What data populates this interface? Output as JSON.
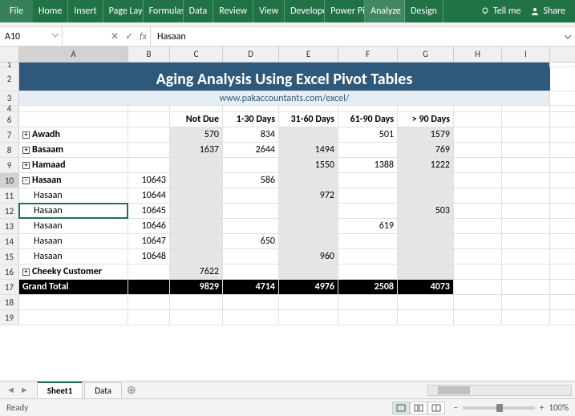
{
  "ribbon": {
    "tabs": [
      "File",
      "Home",
      "Insert",
      "Page Layout",
      "Formulas",
      "Data",
      "Review",
      "View",
      "Developer",
      "Power Pivot",
      "Analyze",
      "Design"
    ],
    "tellme": "Tell me",
    "share": "Share"
  },
  "namebox": "A10",
  "formula": "Hasaan",
  "columns": [
    "A",
    "B",
    "C",
    "D",
    "E",
    "F",
    "G",
    "H",
    "I"
  ],
  "title": "Aging Analysis Using Excel Pivot Tables",
  "url": "www.pakaccountants.com/excel/",
  "headers": {
    "c": "Not Due",
    "d": "1-30 Days",
    "e": "31-60 Days",
    "f": "61-90 Days",
    "g": "> 90 Days"
  },
  "rows": {
    "awadh": {
      "label": "Awadh",
      "exp": "+",
      "c": "570",
      "d": "834",
      "f": "501",
      "g": "1579"
    },
    "basaam": {
      "label": "Basaam",
      "exp": "+",
      "c": "1637",
      "d": "2644",
      "e": "1494",
      "g": "769"
    },
    "hamaad": {
      "label": "Hamaad",
      "exp": "+",
      "e": "1550",
      "f": "1388",
      "g": "1222"
    },
    "hasaan": {
      "label": "Hasaan",
      "exp": "−",
      "b": "10643",
      "d": "586"
    },
    "h1": {
      "label": "Hasaan",
      "b": "10644",
      "e": "972"
    },
    "h2": {
      "label": "Hasaan",
      "b": "10645",
      "g": "503"
    },
    "h3": {
      "label": "Hasaan",
      "b": "10646",
      "f": "619"
    },
    "h4": {
      "label": "Hasaan",
      "b": "10647",
      "d": "650"
    },
    "h5": {
      "label": "Hasaan",
      "b": "10648",
      "e": "960"
    },
    "cheeky": {
      "label": "Cheeky Customer",
      "exp": "+",
      "c": "7622"
    },
    "gt": {
      "label": "Grand Total",
      "c": "9829",
      "d": "4714",
      "e": "4976",
      "f": "2508",
      "g": "4073"
    }
  },
  "sheets": {
    "active": "Sheet1",
    "other": "Data"
  },
  "status": {
    "ready": "Ready",
    "zoom": "100%"
  }
}
